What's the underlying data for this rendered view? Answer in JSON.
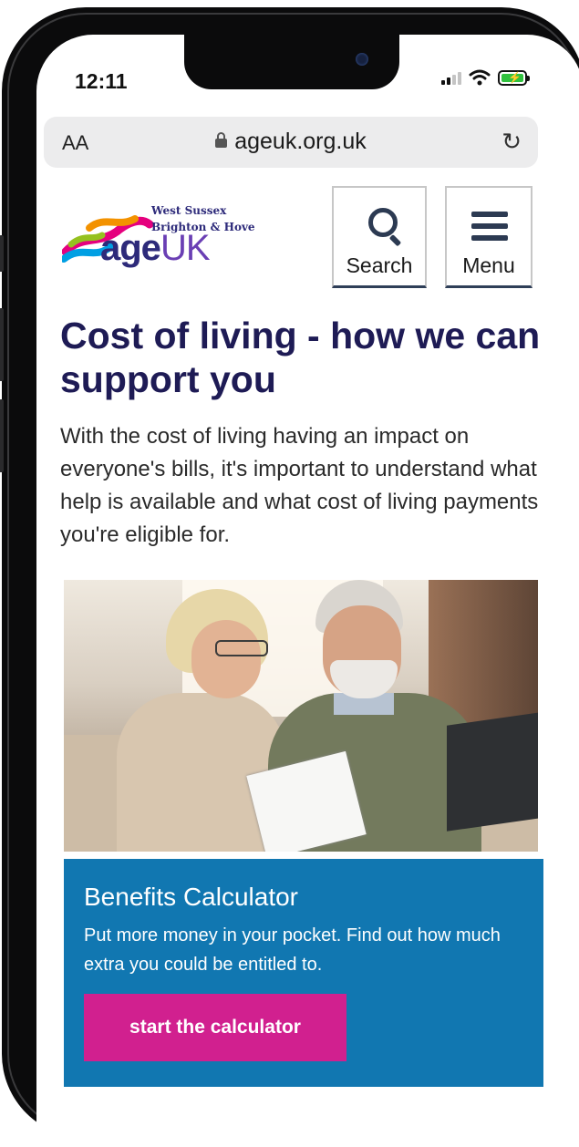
{
  "status_bar": {
    "time": "12:11"
  },
  "address_bar": {
    "aa_label": "AA",
    "url": "ageuk.org.uk"
  },
  "logo": {
    "line1": "West Sussex",
    "line2": "Brighton & Hove",
    "word_age": "age",
    "word_uk": "UK"
  },
  "header": {
    "search_label": "Search",
    "menu_label": "Menu"
  },
  "main": {
    "title": "Cost of living - how we can support you",
    "intro": "With the cost of living having an impact on everyone's bills, it's important to understand what help is available and what cost of living payments you're eligible for."
  },
  "calculator": {
    "title": "Benefits Calculator",
    "description": "Put more money in your pocket. Find out how much extra you could be entitled to.",
    "button_label": "start the calculator"
  },
  "icons": {
    "search": "search-icon",
    "menu": "hamburger-icon",
    "reload": "reload-icon",
    "lock": "lock-icon",
    "signal": "signal-icon",
    "wifi": "wifi-icon",
    "battery": "battery-charging-icon"
  },
  "colors": {
    "brand_navy": "#1e1b55",
    "calculator_blue": "#1177b1",
    "cta_pink": "#d1208f",
    "battery_green": "#31c23f"
  }
}
